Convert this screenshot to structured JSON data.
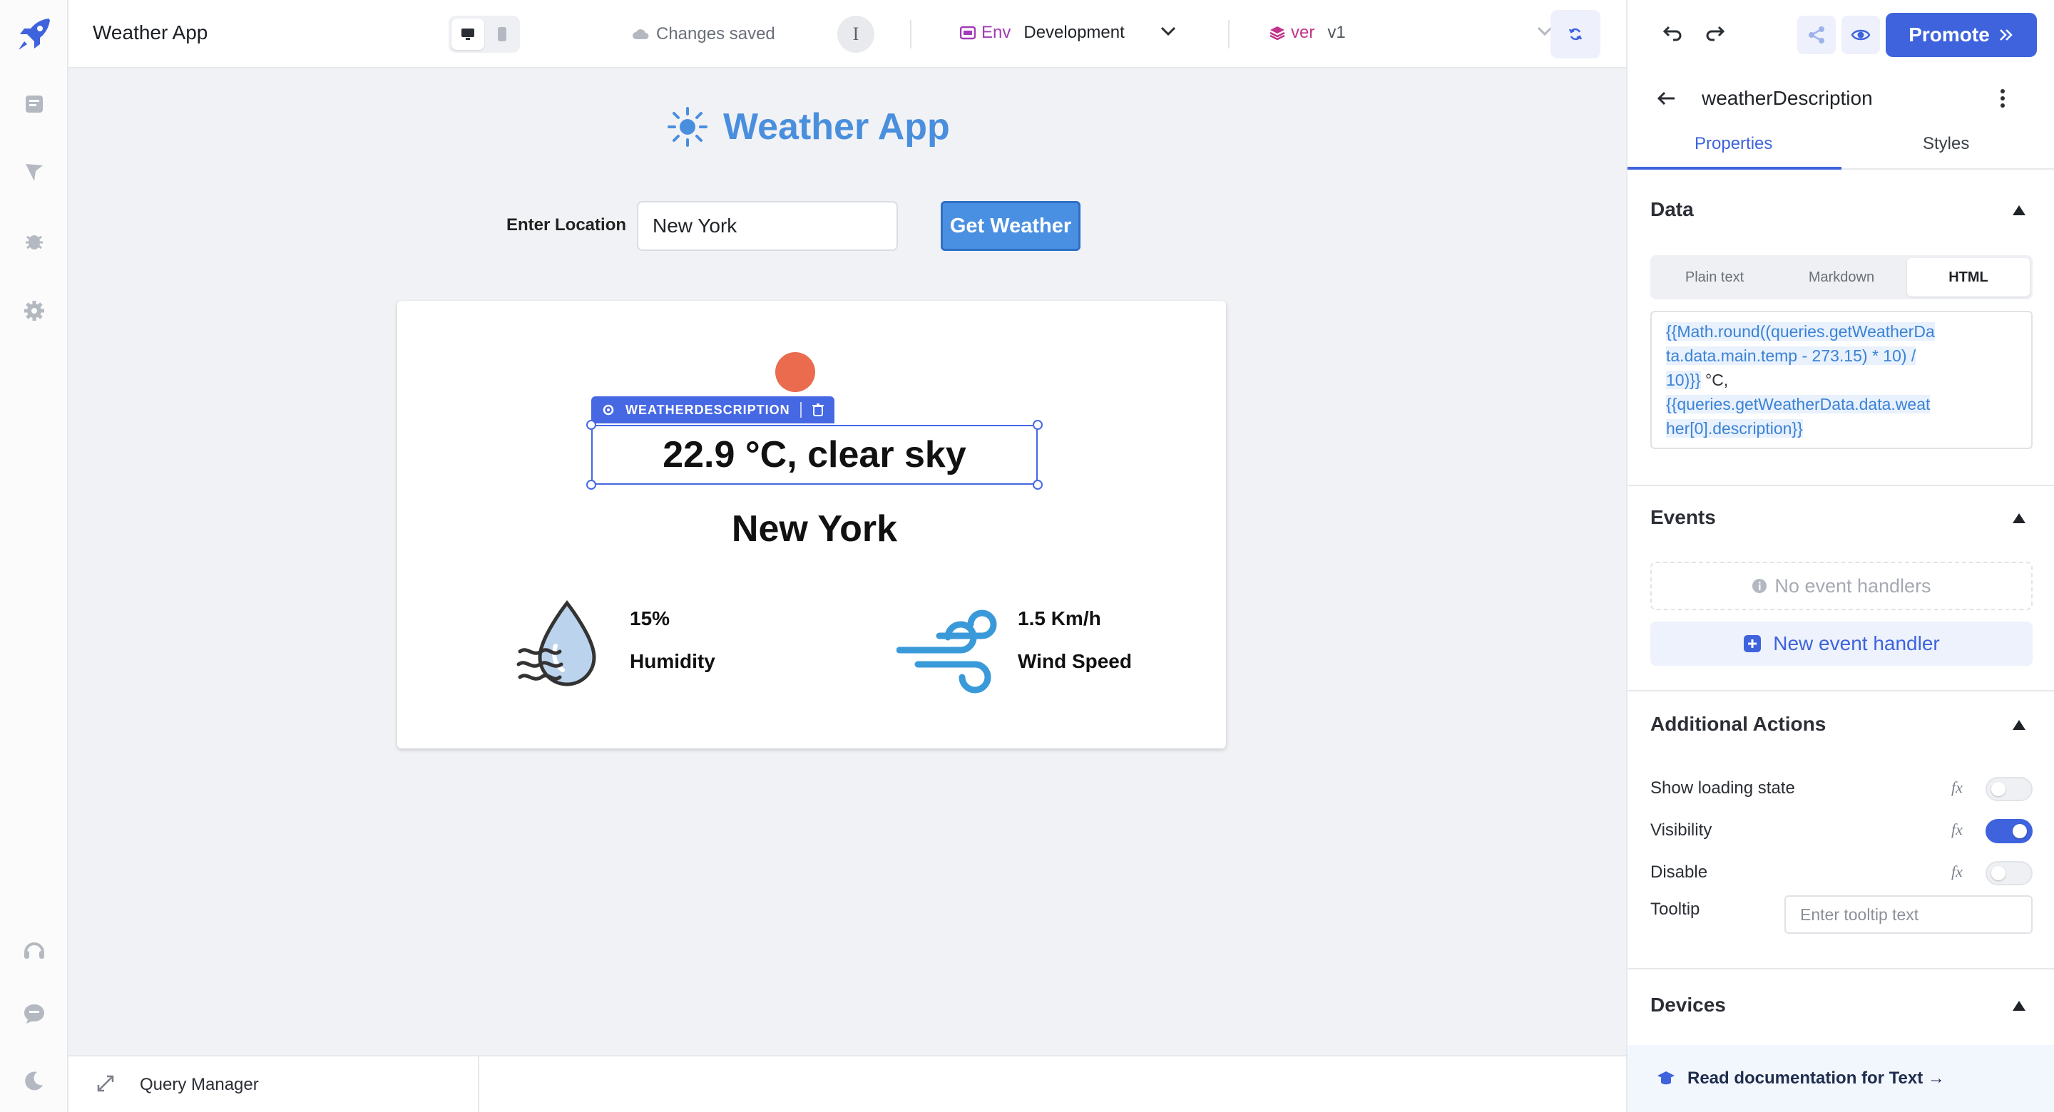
{
  "header": {
    "app_title": "Weather App",
    "save_status": "Changes saved",
    "info_label": "I",
    "env_tag": "Env",
    "env_value": "Development",
    "ver_tag": "ver",
    "ver_value": "v1",
    "promote_label": "Promote"
  },
  "canvas": {
    "app_heading": "Weather App",
    "location_label": "Enter Location",
    "location_value": "New York",
    "get_weather_label": "Get Weather",
    "selected_component_tag": "WEATHERDESCRIPTION",
    "weather_description": "22.9 °C, clear sky",
    "city": "New York",
    "humidity_value": "15%",
    "humidity_label": "Humidity",
    "wind_value": "1.5 Km/h",
    "wind_label": "Wind Speed"
  },
  "query_manager": {
    "label": "Query Manager"
  },
  "panel": {
    "component_name": "weatherDescription",
    "tabs": [
      "Properties",
      "Styles"
    ],
    "active_tab": "Properties",
    "sections": {
      "data": "Data",
      "events": "Events",
      "additional_actions": "Additional Actions",
      "devices": "Devices"
    },
    "format_options": [
      "Plain text",
      "Markdown",
      "HTML"
    ],
    "format_selected": "HTML",
    "code_lines": [
      "{{Math.round((queries.getWeatherDa",
      "ta.data.main.temp - 273.15) * 10) /",
      "10)}}",
      " °C,",
      "{{queries.getWeatherData.data.weat",
      "her[0].description}}"
    ],
    "no_events_text": "No event handlers",
    "new_event_label": "New event handler",
    "actions": [
      {
        "label": "Show loading state",
        "enabled": false
      },
      {
        "label": "Visibility",
        "enabled": true
      },
      {
        "label": "Disable",
        "enabled": false
      }
    ],
    "fx_label": "fx",
    "tooltip_label": "Tooltip",
    "tooltip_placeholder": "Enter tooltip text",
    "docs_link": "Read documentation for Text →"
  },
  "colors": {
    "accent": "#3e63dd",
    "heading_blue": "#4a8fdd",
    "sun_dot": "#ea6b4e"
  }
}
